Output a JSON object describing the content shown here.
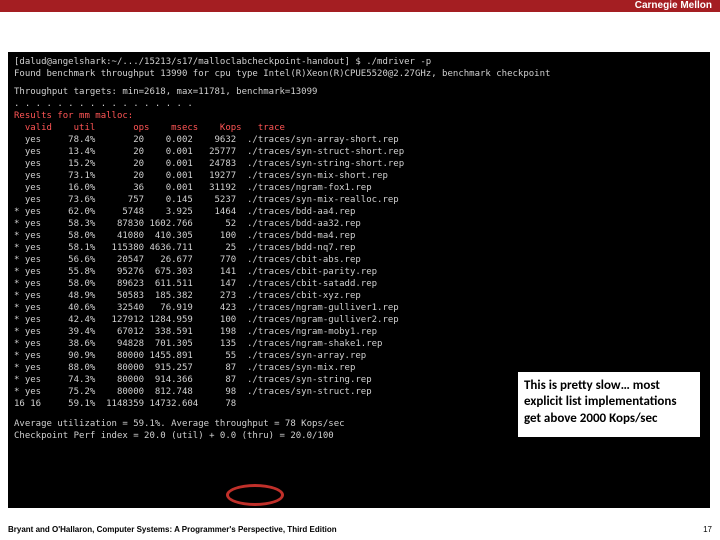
{
  "brand": "Carnegie Mellon",
  "terminal": {
    "prompt": "[dalud@angelshark:~/.../15213/s17/malloclabcheckpoint-handout] $ ./mdriver -p",
    "found": "Found benchmark throughput 13990 for cpu type Intel(R)Xeon(R)CPUE5520@2.27GHz, benchmark checkpoint",
    "targets": "Throughput targets: min=2618, max=11781, benchmark=13099",
    "dots": ". . . . . . . . . . . . . . . . .",
    "results_header": "Results for mm malloc:",
    "columns": "  valid    util       ops    msecs    Kops   trace",
    "rows": [
      "  yes     78.4%       20    0.002    9632  ./traces/syn-array-short.rep",
      "  yes     13.4%       20    0.001   25777  ./traces/syn-struct-short.rep",
      "  yes     15.2%       20    0.001   24783  ./traces/syn-string-short.rep",
      "  yes     73.1%       20    0.001   19277  ./traces/syn-mix-short.rep",
      "  yes     16.0%       36    0.001   31192  ./traces/ngram-fox1.rep",
      "  yes     73.6%      757    0.145    5237  ./traces/syn-mix-realloc.rep",
      "* yes     62.0%     5748    3.925    1464  ./traces/bdd-aa4.rep",
      "* yes     58.3%    87830 1602.766      52  ./traces/bdd-aa32.rep",
      "* yes     58.0%    41080  410.305     100  ./traces/bdd-ma4.rep",
      "* yes     58.1%   115380 4636.711      25  ./traces/bdd-nq7.rep",
      "* yes     56.6%    20547   26.677     770  ./traces/cbit-abs.rep",
      "* yes     55.8%    95276  675.303     141  ./traces/cbit-parity.rep",
      "* yes     58.0%    89623  611.511     147  ./traces/cbit-satadd.rep",
      "* yes     48.9%    50583  185.382     273  ./traces/cbit-xyz.rep",
      "* yes     40.6%    32540   76.919     423  ./traces/ngram-gulliver1.rep",
      "* yes     42.4%   127912 1284.959     100  ./traces/ngram-gulliver2.rep",
      "* yes     39.4%    67012  338.591     198  ./traces/ngram-moby1.rep",
      "* yes     38.6%    94828  701.305     135  ./traces/ngram-shake1.rep",
      "* yes     90.9%    80000 1455.891      55  ./traces/syn-array.rep",
      "* yes     88.0%    80000  915.257      87  ./traces/syn-mix.rep",
      "* yes     74.3%    80000  914.366      87  ./traces/syn-string.rep",
      "* yes     75.2%    80000  812.748      98  ./traces/syn-struct.rep",
      "16 16     59.1%  1148359 14732.604     78"
    ],
    "average": "Average utilization = 59.1%. Average throughput = 78 Kops/sec",
    "checkpoint": "Checkpoint Perf index = 20.0 (util) + 0.0 (thru) = 20.0/100"
  },
  "note": "This is pretty slow… most explicit list implementations get above 2000 Kops/sec",
  "footer_left": "Bryant and O'Hallaron, Computer Systems: A Programmer's Perspective, Third Edition",
  "footer_right": "17"
}
